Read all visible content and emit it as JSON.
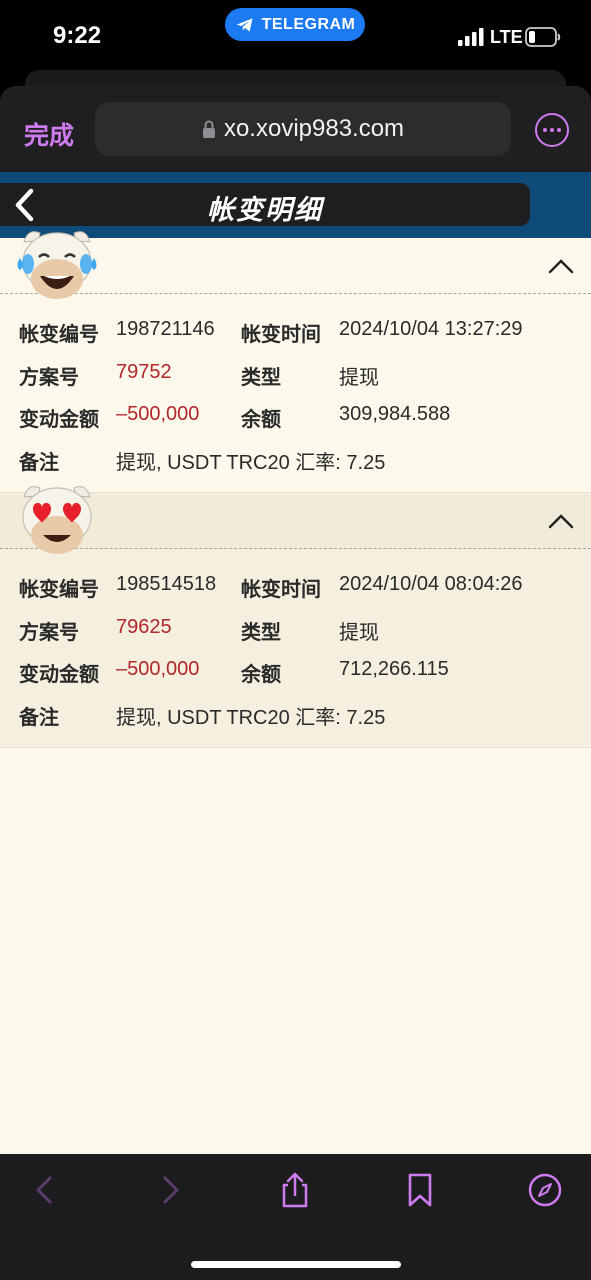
{
  "status_bar": {
    "time": "9:22",
    "back_app": "TELEGRAM",
    "network": "LTE"
  },
  "browser": {
    "done_label": "完成",
    "url": "xo.xovip983.com",
    "accent_color": "#cf7bf0"
  },
  "page": {
    "title": "帐变明细",
    "header_color": "#0f4b78"
  },
  "labels": {
    "change_id": "帐变编号",
    "change_time": "帐变时间",
    "plan_no": "方案号",
    "type": "类型",
    "amount": "变动金额",
    "balance": "余额",
    "remark": "备注"
  },
  "records": [
    {
      "avatar": "cow-laughing-tears-icon",
      "change_id": "198721146",
      "change_time": "2024/10/04 13:27:29",
      "plan_no": "79752",
      "type": "提现",
      "amount": "–500,000",
      "balance": "309,984.588",
      "remark": "提现, USDT TRC20 汇率: 7.25"
    },
    {
      "avatar": "cow-heart-eyes-icon",
      "change_id": "198514518",
      "change_time": "2024/10/04 08:04:26",
      "plan_no": "79625",
      "type": "提现",
      "amount": "–500,000",
      "balance": "712,266.115",
      "remark": "提现, USDT TRC20 汇率: 7.25"
    }
  ],
  "toolbar": {
    "icons": [
      "back-icon",
      "forward-icon",
      "share-icon",
      "bookmarks-icon",
      "compass-icon"
    ]
  }
}
